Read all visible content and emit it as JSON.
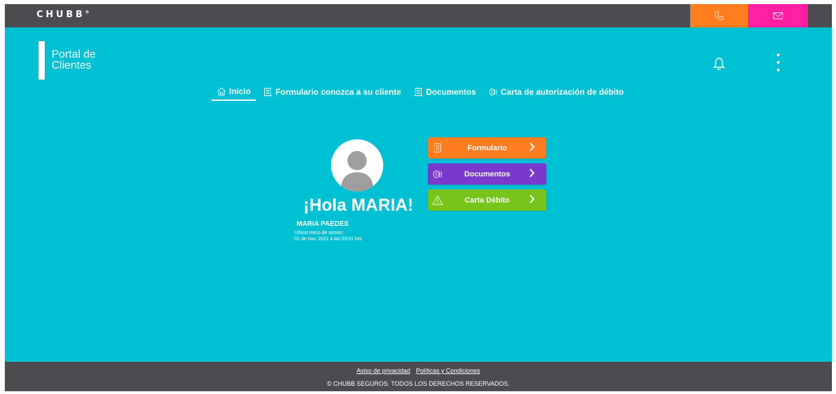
{
  "header": {
    "logo": "CHUBB",
    "logo_mark": "®",
    "phone_icon": "phone-icon",
    "mail_icon": "mail-icon"
  },
  "brand": {
    "title": "Portal de\nClientes"
  },
  "nav": {
    "items": [
      {
        "label": "Inicio",
        "icon": "home-icon",
        "active": true
      },
      {
        "label": "Formulario conozca a su cliente",
        "icon": "form-icon"
      },
      {
        "label": "Documentos",
        "icon": "document-icon"
      },
      {
        "label": "Carta de autorización de débito",
        "icon": "money-icon"
      }
    ]
  },
  "profile": {
    "greeting": "¡Hola MARIA!",
    "name": "MARIA PAEDES",
    "last_login_label": "Último inicio de sesión:",
    "last_login_value": "01 de nov. 2021 a las 09:51 hrs."
  },
  "actions": [
    {
      "label": "Formulario",
      "icon": "form-icon",
      "color": "#ff7d1e"
    },
    {
      "label": "Documentos",
      "icon": "money-icon",
      "color": "#7a39cc"
    },
    {
      "label": "Carta Débito",
      "icon": "warning-icon",
      "color": "#79c41a"
    }
  ],
  "footer": {
    "privacy": "Aviso de privacidad",
    "policies": "Políticas y Condiciones",
    "copyright": "© CHUBB SEGUROS. TODOS LOS DERECHOS RESERVADOS."
  },
  "colors": {
    "background": "#00c1d4",
    "bars": "#4a4c50",
    "phone": "#ff7d1e",
    "mail": "#ff1fa3"
  }
}
